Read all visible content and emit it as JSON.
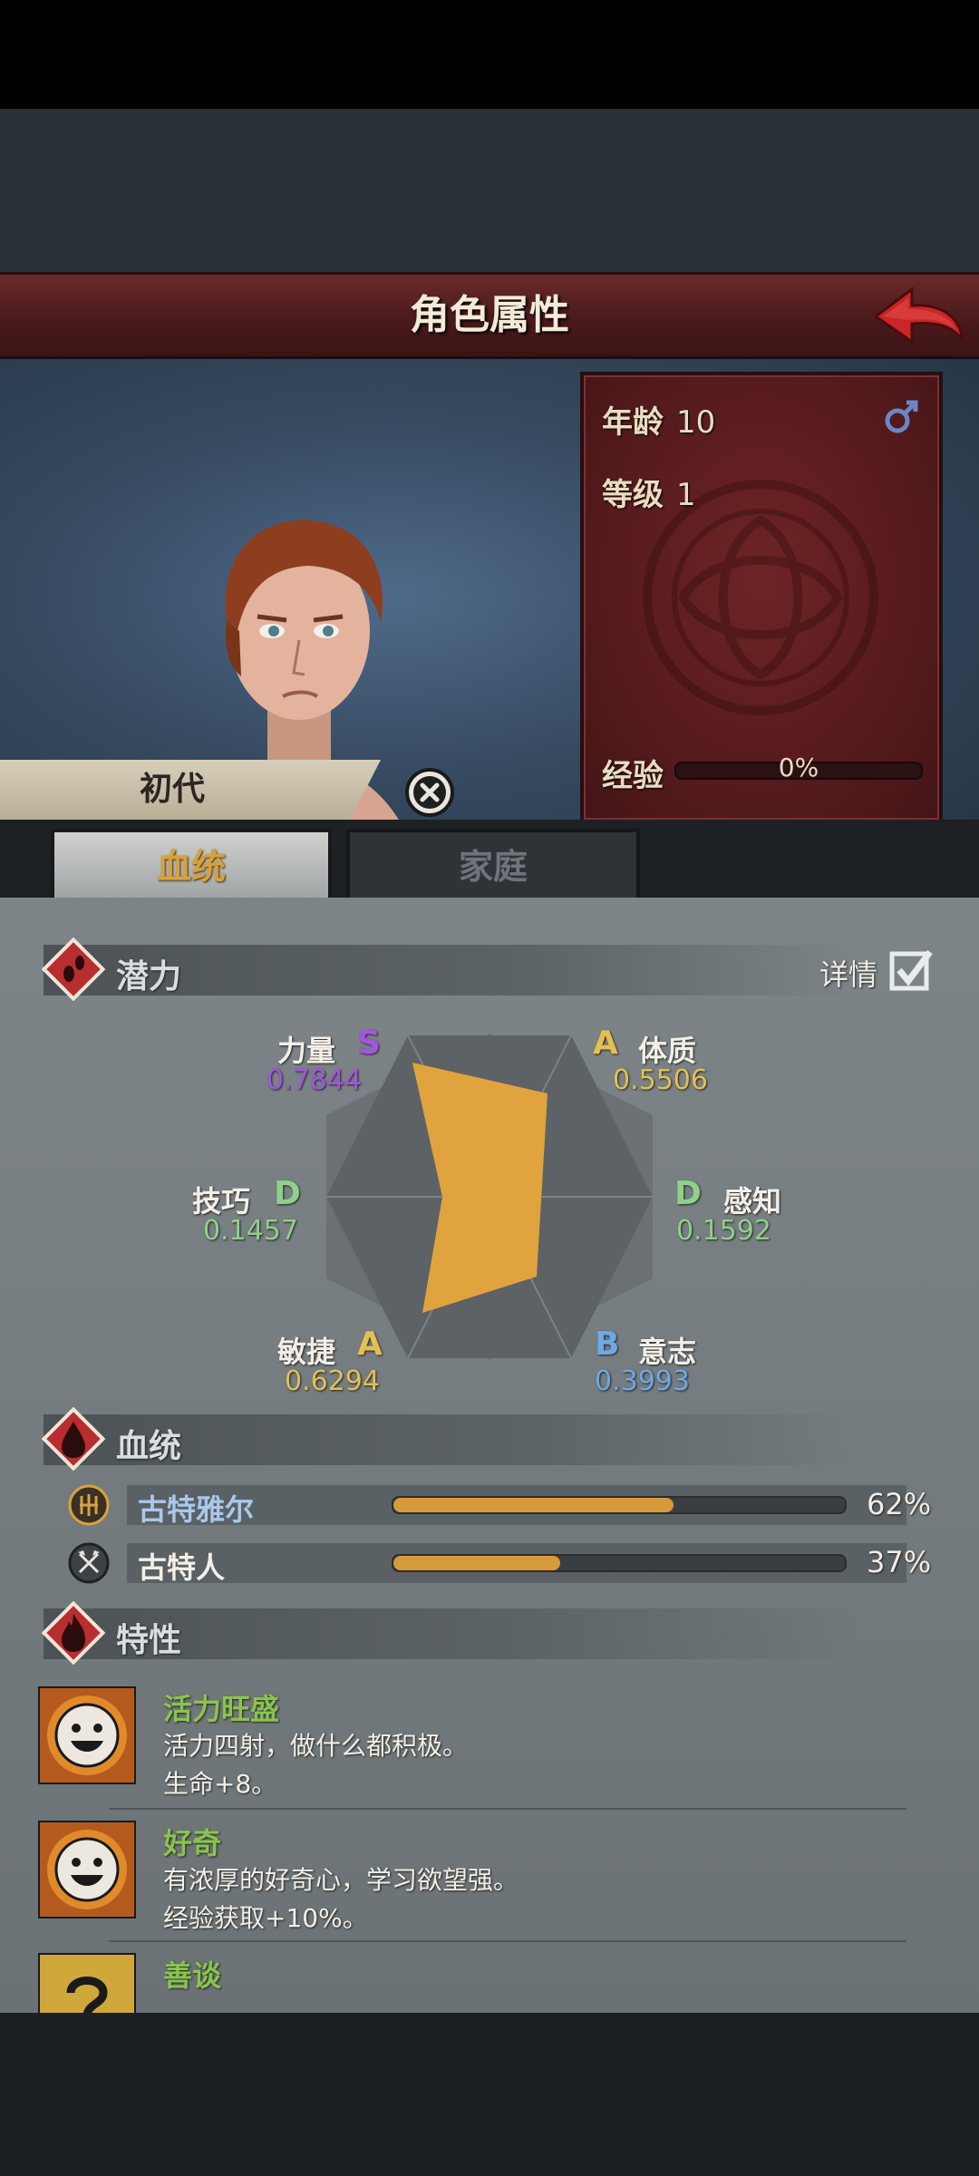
{
  "header": {
    "title": "角色属性",
    "back_icon": "red-curved-arrow-back-icon"
  },
  "character": {
    "age_label": "年龄",
    "age_value": "10",
    "level_label": "等级",
    "level_value": "1",
    "gender_icon": "male-icon",
    "exp_label": "经验",
    "exp_value": "0%",
    "exp_progress": 0,
    "generation": "初代"
  },
  "tabs": [
    {
      "label": "血统",
      "active": true
    },
    {
      "label": "家庭",
      "active": false
    }
  ],
  "potential": {
    "title": "潜力",
    "detail_label": "详情",
    "detail_checked": true,
    "attributes": [
      {
        "name": "力量",
        "grade": "S",
        "value": "0.7844",
        "color": "#a455e0"
      },
      {
        "name": "体质",
        "grade": "A",
        "value": "0.5506",
        "color": "#e2c052"
      },
      {
        "name": "感知",
        "grade": "D",
        "value": "0.1592",
        "color": "#8fd08a"
      },
      {
        "name": "意志",
        "grade": "B",
        "value": "0.3993",
        "color": "#6ea8e6"
      },
      {
        "name": "敏捷",
        "grade": "A",
        "value": "0.6294",
        "color": "#e2c052"
      },
      {
        "name": "技巧",
        "grade": "D",
        "value": "0.1457",
        "color": "#8fd08a"
      }
    ],
    "radar_fill_color": "#e0a33e"
  },
  "lineage": {
    "title": "血统",
    "items": [
      {
        "name": "古特雅尔",
        "percent": "62%",
        "ratio": 0.62,
        "name_color": "#a9c8ea",
        "icon": "gutyar-emblem-icon"
      },
      {
        "name": "古特人",
        "percent": "37%",
        "ratio": 0.37,
        "name_color": "#f3efe6",
        "icon": "crossed-axes-icon"
      }
    ]
  },
  "traits": {
    "title": "特性",
    "items": [
      {
        "name": "活力旺盛",
        "desc": "活力四射，做什么都积极。",
        "effect": "生命+8。",
        "icon": "smiley-face-icon"
      },
      {
        "name": "好奇",
        "desc": "有浓厚的好奇心，学习欲望强。",
        "effect": "经验获取+10%。",
        "icon": "smiley-face-icon"
      },
      {
        "name": "善谈",
        "desc": "",
        "effect": "",
        "icon": "question-mark-icon"
      }
    ]
  }
}
